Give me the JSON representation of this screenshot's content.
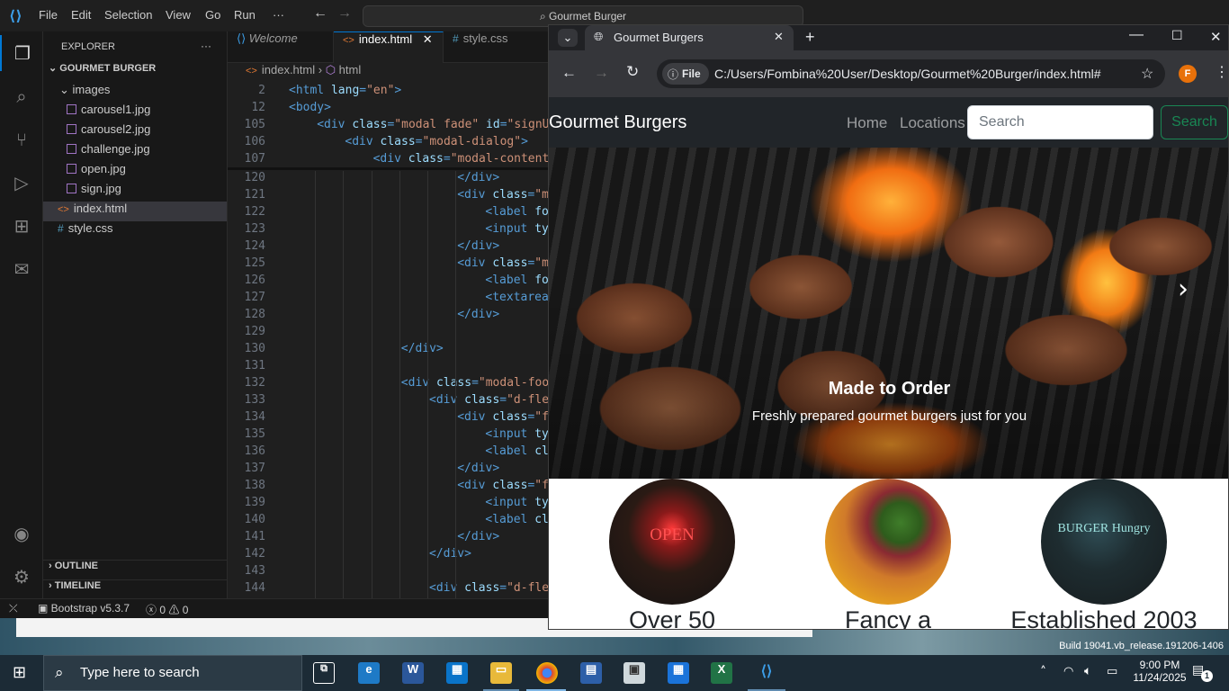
{
  "vscode": {
    "menu": [
      "File",
      "Edit",
      "Selection",
      "View",
      "Go",
      "Run",
      "···"
    ],
    "command_center": "Gourmet Burger",
    "explorer": {
      "title": "EXPLORER",
      "more": "···",
      "root": "GOURMET BURGER",
      "folder": "images",
      "images": [
        "carousel1.jpg",
        "carousel2.jpg",
        "challenge.jpg",
        "open.jpg",
        "sign.jpg"
      ],
      "files": [
        "index.html",
        "style.css"
      ],
      "outline": "OUTLINE",
      "timeline": "TIMELINE"
    },
    "tabs": [
      "Welcome",
      "index.html",
      "style.css"
    ],
    "breadcrumb": {
      "file": "index.html",
      "node": "html"
    },
    "sticky_lines": [
      {
        "num": "2",
        "indent": 0,
        "parts": [
          [
            "t",
            "<html "
          ],
          [
            "a",
            "lang"
          ],
          [
            "t",
            "="
          ],
          [
            "s",
            "\"en\""
          ],
          [
            "t",
            ">"
          ]
        ]
      },
      {
        "num": "12",
        "indent": 0,
        "parts": [
          [
            "t",
            "<body>"
          ]
        ]
      },
      {
        "num": "105",
        "indent": 1,
        "parts": [
          [
            "t",
            "<div "
          ],
          [
            "a",
            "class"
          ],
          [
            "t",
            "="
          ],
          [
            "s",
            "\"modal fade\""
          ],
          [
            "a",
            " id"
          ],
          [
            "t",
            "="
          ],
          [
            "s",
            "\"signUp"
          ]
        ]
      },
      {
        "num": "106",
        "indent": 2,
        "parts": [
          [
            "t",
            "<div "
          ],
          [
            "a",
            "class"
          ],
          [
            "t",
            "="
          ],
          [
            "s",
            "\"modal-dialog\""
          ],
          [
            "t",
            ">"
          ]
        ]
      },
      {
        "num": "107",
        "indent": 3,
        "parts": [
          [
            "t",
            "<div "
          ],
          [
            "a",
            "class"
          ],
          [
            "t",
            "="
          ],
          [
            "s",
            "\"modal-content\""
          ]
        ]
      }
    ],
    "code_lines": [
      {
        "num": "120",
        "indent": 6,
        "parts": [
          [
            "t",
            "</div>"
          ]
        ]
      },
      {
        "num": "121",
        "indent": 6,
        "parts": [
          [
            "t",
            "<div "
          ],
          [
            "a",
            "class"
          ],
          [
            "t",
            "="
          ],
          [
            "s",
            "\"mb"
          ]
        ]
      },
      {
        "num": "122",
        "indent": 7,
        "parts": [
          [
            "t",
            "<label "
          ],
          [
            "a",
            "for"
          ]
        ]
      },
      {
        "num": "123",
        "indent": 7,
        "parts": [
          [
            "t",
            "<input "
          ],
          [
            "a",
            "typ"
          ]
        ]
      },
      {
        "num": "124",
        "indent": 6,
        "parts": [
          [
            "t",
            "</div>"
          ]
        ]
      },
      {
        "num": "125",
        "indent": 6,
        "parts": [
          [
            "t",
            "<div "
          ],
          [
            "a",
            "class"
          ],
          [
            "t",
            "="
          ],
          [
            "s",
            "\"mb"
          ]
        ]
      },
      {
        "num": "126",
        "indent": 7,
        "parts": [
          [
            "t",
            "<label "
          ],
          [
            "a",
            "for"
          ]
        ]
      },
      {
        "num": "127",
        "indent": 7,
        "parts": [
          [
            "t",
            "<textarea"
          ]
        ]
      },
      {
        "num": "128",
        "indent": 6,
        "parts": [
          [
            "t",
            "</div>"
          ]
        ]
      },
      {
        "num": "129",
        "indent": 0,
        "parts": []
      },
      {
        "num": "130",
        "indent": 4,
        "parts": [
          [
            "t",
            "</div>"
          ]
        ]
      },
      {
        "num": "131",
        "indent": 0,
        "parts": []
      },
      {
        "num": "132",
        "indent": 4,
        "parts": [
          [
            "t",
            "<div "
          ],
          [
            "a",
            "class"
          ],
          [
            "t",
            "="
          ],
          [
            "s",
            "\"modal-foot"
          ]
        ]
      },
      {
        "num": "133",
        "indent": 5,
        "parts": [
          [
            "t",
            "<div "
          ],
          [
            "a",
            "class"
          ],
          [
            "t",
            "="
          ],
          [
            "s",
            "\"d-flex"
          ]
        ]
      },
      {
        "num": "134",
        "indent": 6,
        "parts": [
          [
            "t",
            "<div "
          ],
          [
            "a",
            "class"
          ],
          [
            "t",
            "="
          ],
          [
            "s",
            "\"fo"
          ]
        ]
      },
      {
        "num": "135",
        "indent": 7,
        "parts": [
          [
            "t",
            "<input "
          ],
          [
            "a",
            "typ"
          ]
        ]
      },
      {
        "num": "136",
        "indent": 7,
        "parts": [
          [
            "t",
            "<label "
          ],
          [
            "a",
            "cla"
          ]
        ]
      },
      {
        "num": "137",
        "indent": 6,
        "parts": [
          [
            "t",
            "</div>"
          ]
        ]
      },
      {
        "num": "138",
        "indent": 6,
        "parts": [
          [
            "t",
            "<div "
          ],
          [
            "a",
            "class"
          ],
          [
            "t",
            "="
          ],
          [
            "s",
            "\"fo"
          ]
        ]
      },
      {
        "num": "139",
        "indent": 7,
        "parts": [
          [
            "t",
            "<input "
          ],
          [
            "a",
            "typ"
          ]
        ]
      },
      {
        "num": "140",
        "indent": 7,
        "parts": [
          [
            "t",
            "<label "
          ],
          [
            "a",
            "cla"
          ]
        ]
      },
      {
        "num": "141",
        "indent": 6,
        "parts": [
          [
            "t",
            "</div>"
          ]
        ]
      },
      {
        "num": "142",
        "indent": 5,
        "parts": [
          [
            "t",
            "</div>"
          ]
        ]
      },
      {
        "num": "143",
        "indent": 0,
        "parts": []
      },
      {
        "num": "144",
        "indent": 5,
        "parts": [
          [
            "t",
            "<div "
          ],
          [
            "a",
            "class"
          ],
          [
            "t",
            "="
          ],
          [
            "s",
            "\"d-flex"
          ]
        ]
      }
    ],
    "status": {
      "bootstrap": "Bootstrap v5.3.7",
      "errors": "0",
      "warnings": "0"
    }
  },
  "chrome": {
    "tab_title": "Gourmet Burgers",
    "address": "C:/Users/Fombina%20User/Desktop/Gourmet%20Burger/index.html#",
    "scheme_chip": "File",
    "profile_initial": "F"
  },
  "website": {
    "brand": "Gourmet Burgers",
    "nav": [
      "Home",
      "Locations"
    ],
    "search_placeholder": "Search",
    "search_button": "Search",
    "carousel": {
      "caption_title": "Made to Order",
      "caption_text": "Freshly prepared gourmet burgers just for you"
    },
    "features": [
      {
        "title": "Over 50",
        "image_text": "OPEN"
      },
      {
        "title": "Fancy a",
        "image_text": ""
      },
      {
        "title": "Established 2003",
        "image_text": "BURGER Hungry"
      }
    ]
  },
  "desktop": {
    "build": "Build 19041.vb_release.191206-1406"
  },
  "taskbar": {
    "search_placeholder": "Type here to search",
    "time": "9:00 PM",
    "date": "11/24/2025",
    "notifications": "1"
  }
}
